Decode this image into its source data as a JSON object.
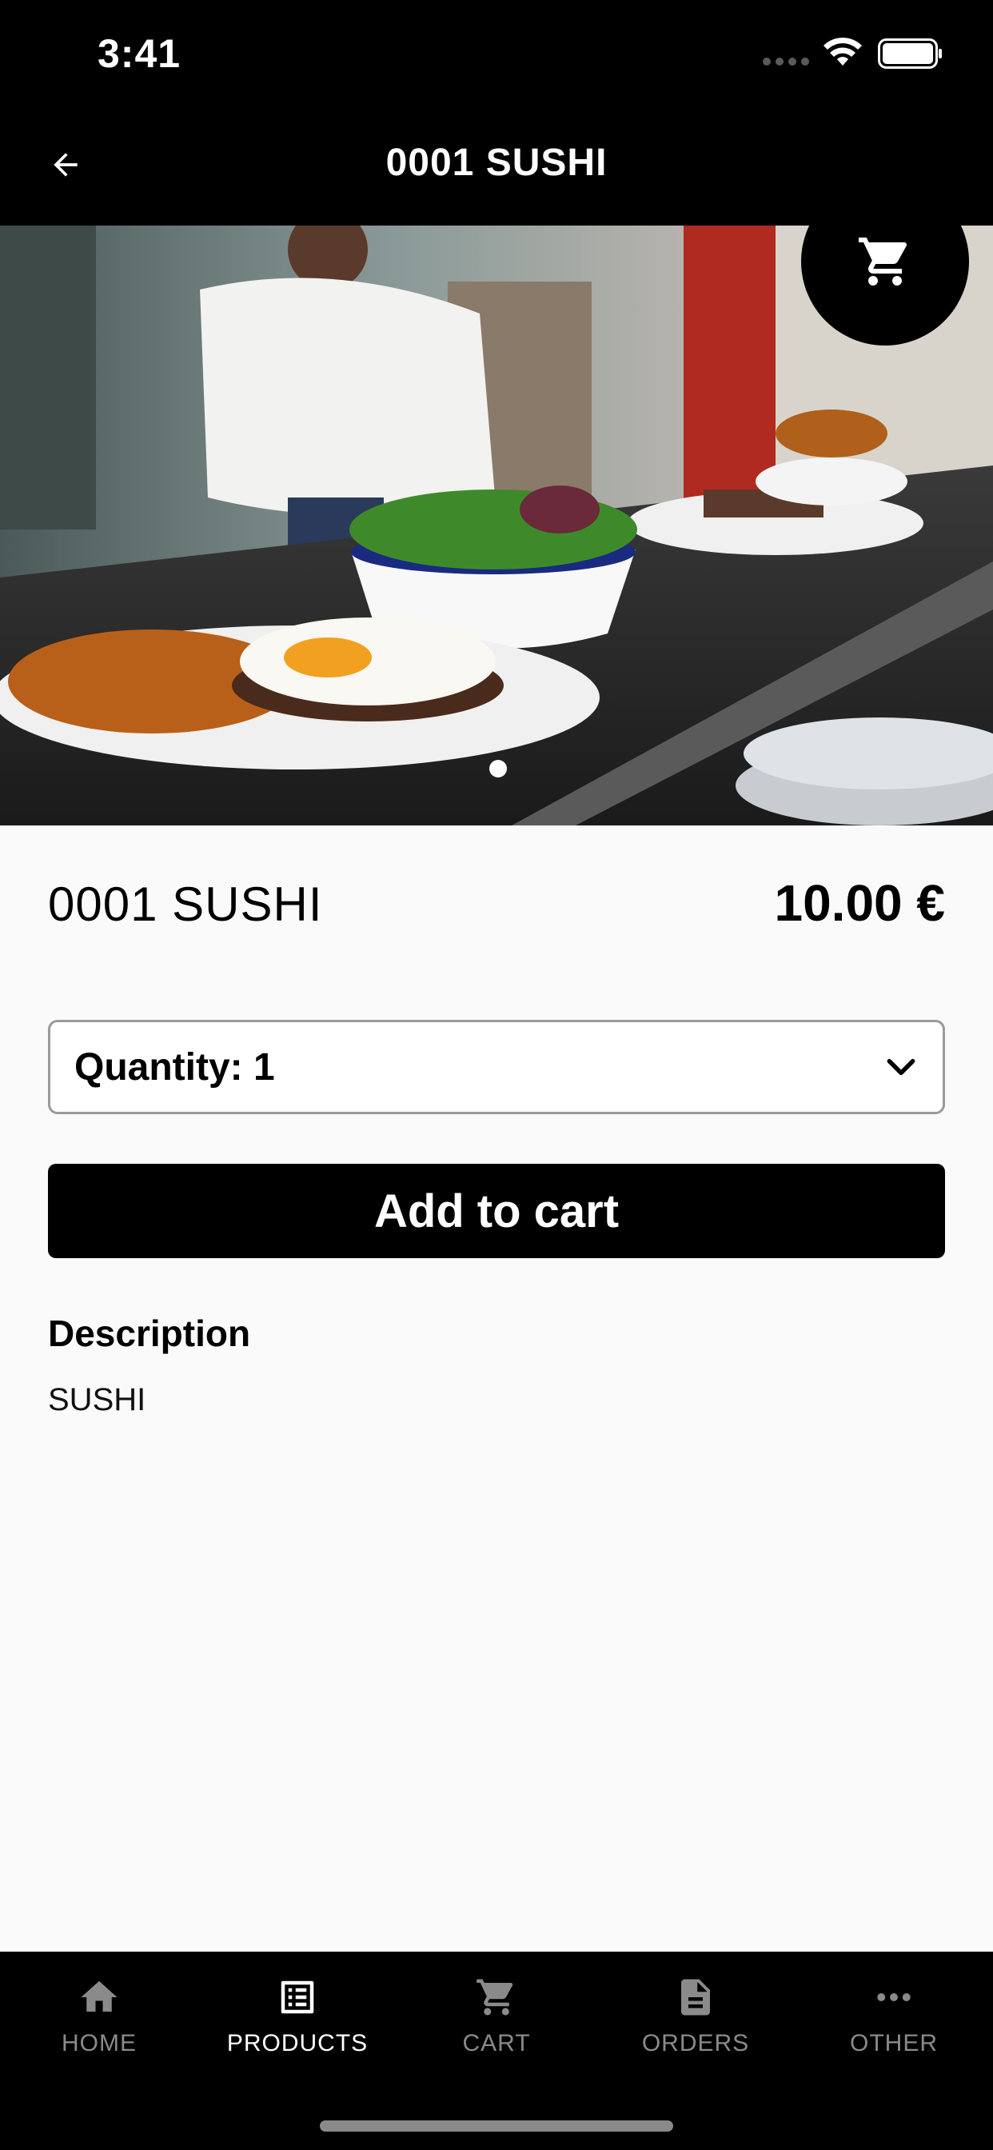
{
  "status_bar": {
    "time": "3:41"
  },
  "header": {
    "title": "0001 SUSHI"
  },
  "hero": {
    "image_description": "restaurant-food-photo",
    "slide_index": 1,
    "slide_count": 1
  },
  "product": {
    "name": "0001 SUSHI",
    "price": "10.00 €",
    "quantity_label": "Quantity: 1",
    "add_to_cart_label": "Add to cart",
    "description_heading": "Description",
    "description_text": "SUSHI"
  },
  "bottom_nav": {
    "items": [
      {
        "label": "HOME",
        "icon": "home-icon",
        "active": false
      },
      {
        "label": "PRODUCTS",
        "icon": "list-icon",
        "active": true
      },
      {
        "label": "CART",
        "icon": "cart-icon",
        "active": false
      },
      {
        "label": "ORDERS",
        "icon": "document-icon",
        "active": false
      },
      {
        "label": "OTHER",
        "icon": "more-icon",
        "active": false
      }
    ]
  },
  "colors": {
    "header_bg": "#000000",
    "page_bg": "#fafafa",
    "accent": "#000000",
    "inactive_nav": "#8a8a8a"
  }
}
